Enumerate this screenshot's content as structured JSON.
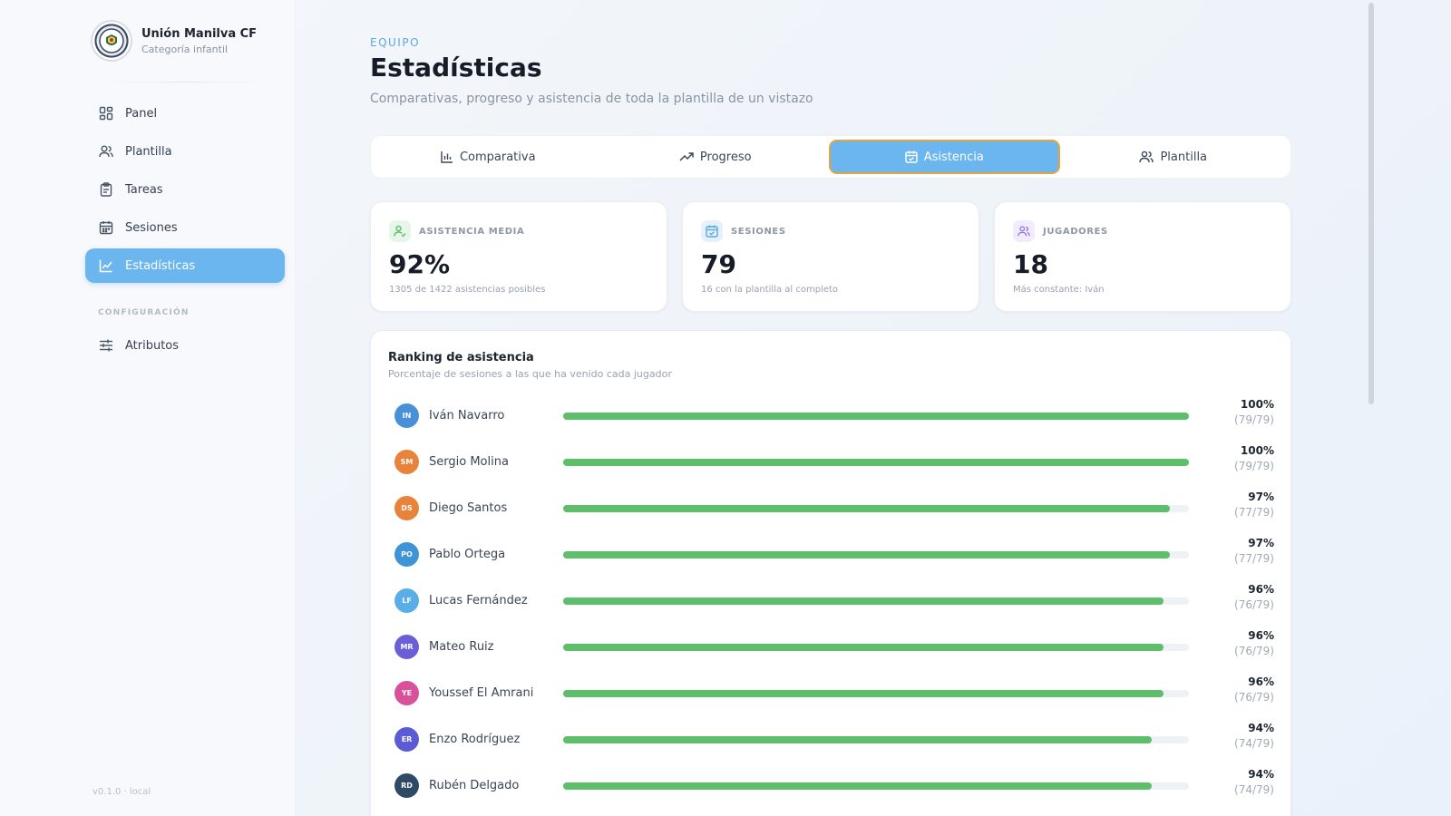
{
  "sidebar": {
    "brand_name": "Unión Manilva CF",
    "brand_sub": "Categoría infantil",
    "items": [
      {
        "label": "Panel",
        "icon": "grid-icon"
      },
      {
        "label": "Plantilla",
        "icon": "users-icon"
      },
      {
        "label": "Tareas",
        "icon": "clipboard-icon"
      },
      {
        "label": "Sesiones",
        "icon": "calendar-icon"
      },
      {
        "label": "Estadísticas",
        "icon": "chart-line-icon",
        "active": true
      }
    ],
    "section_label": "CONFIGURACIÓN",
    "config_items": [
      {
        "label": "Atributos",
        "icon": "sliders-icon"
      }
    ],
    "version": "v0.1.0 · local"
  },
  "header": {
    "eyebrow": "EQUIPO",
    "title": "Estadísticas",
    "subtitle": "Comparativas, progreso y asistencia de toda la plantilla de un vistazo"
  },
  "tabs": [
    {
      "label": "Comparativa",
      "icon": "bar-chart-icon"
    },
    {
      "label": "Progreso",
      "icon": "trending-up-icon"
    },
    {
      "label": "Asistencia",
      "icon": "calendar-check-icon",
      "active": true
    },
    {
      "label": "Plantilla",
      "icon": "users-icon"
    }
  ],
  "stats": [
    {
      "label": "ASISTENCIA MEDIA",
      "value": "92%",
      "sub": "1305 de 1422 asistencias posibles",
      "icon": "user-check-icon",
      "color": "#5dbf6a"
    },
    {
      "label": "SESIONES",
      "value": "79",
      "sub": "16 con la plantilla al completo",
      "icon": "calendar-check-icon",
      "color": "#5aa8e6"
    },
    {
      "label": "JUGADORES",
      "value": "18",
      "sub": "Más constante: Iván",
      "icon": "users-icon",
      "color": "#8f6fd8"
    }
  ],
  "ranking": {
    "title": "Ranking de asistencia",
    "subtitle": "Porcentaje de sesiones a las que ha venido cada jugador",
    "bar_color": "#5dbf6a",
    "players": [
      {
        "initials": "IN",
        "name": "Iván Navarro",
        "percent": 100,
        "percent_label": "100%",
        "count_label": "(79/79)",
        "color": "#4a90d9"
      },
      {
        "initials": "SM",
        "name": "Sergio Molina",
        "percent": 100,
        "percent_label": "100%",
        "count_label": "(79/79)",
        "color": "#e7833a"
      },
      {
        "initials": "DS",
        "name": "Diego Santos",
        "percent": 97,
        "percent_label": "97%",
        "count_label": "(77/79)",
        "color": "#e7833a"
      },
      {
        "initials": "PO",
        "name": "Pablo Ortega",
        "percent": 97,
        "percent_label": "97%",
        "count_label": "(77/79)",
        "color": "#3f94d8"
      },
      {
        "initials": "LF",
        "name": "Lucas Fernández",
        "percent": 96,
        "percent_label": "96%",
        "count_label": "(76/79)",
        "color": "#5aaee8"
      },
      {
        "initials": "MR",
        "name": "Mateo Ruiz",
        "percent": 96,
        "percent_label": "96%",
        "count_label": "(76/79)",
        "color": "#6b5fd8"
      },
      {
        "initials": "YE",
        "name": "Youssef El Amrani",
        "percent": 96,
        "percent_label": "96%",
        "count_label": "(76/79)",
        "color": "#d9519a"
      },
      {
        "initials": "ER",
        "name": "Enzo Rodríguez",
        "percent": 94,
        "percent_label": "94%",
        "count_label": "(74/79)",
        "color": "#5b5bd6"
      },
      {
        "initials": "RD",
        "name": "Rubén Delgado",
        "percent": 94,
        "percent_label": "94%",
        "count_label": "(74/79)",
        "color": "#2f4a66"
      }
    ]
  }
}
